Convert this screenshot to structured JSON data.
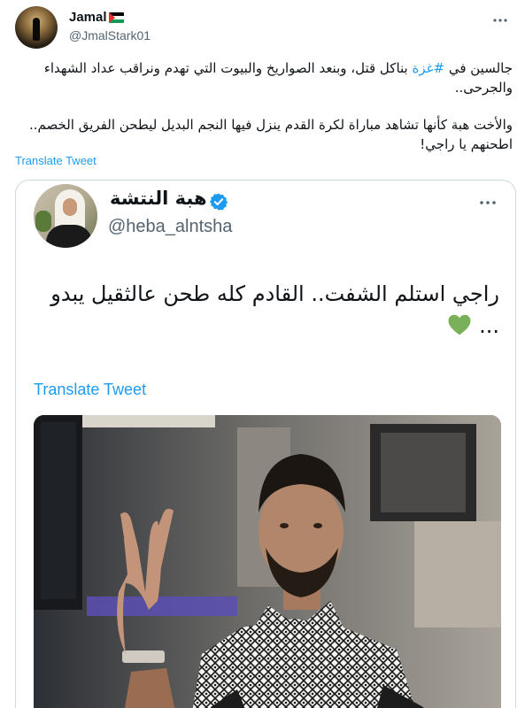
{
  "tweet": {
    "author": {
      "name": "Jamal",
      "flag_icon": "palestine-flag-icon",
      "handle": "@JmalStark01"
    },
    "text": {
      "para1_before": "جالسين في ",
      "hashtag": "#غزة",
      "para1_after": " بناكل قتل، وبنعد الصواريخ والبيوت التي تهدم ونراقب عداد الشهداء والجرحى..",
      "para2": "والأخت هبة كأنها تشاهد مباراة لكرة القدم ينزل فيها النجم البديل ليطحن الفريق الخصم.. اطحنهم يا راجي!"
    },
    "translate_label": "Translate Tweet",
    "more_icon": "more-horizontal-icon"
  },
  "quoted": {
    "author": {
      "name": "هبة النتشة",
      "handle": "@heba_alntsha",
      "verified_icon": "verified-badge-icon"
    },
    "text": "راجي استلم الشفت.. القادم كله طحن عالثقيل يبدو ...",
    "emoji_icon": "green-heart-icon",
    "translate_label": "Translate Tweet",
    "photo_alt": "photo-man-peace-sign-keffiyeh"
  },
  "colors": {
    "accent": "#1d9bf0",
    "text": "#0f1419",
    "secondary": "#536471",
    "border": "#cfd9de",
    "heart": "#78b159"
  }
}
